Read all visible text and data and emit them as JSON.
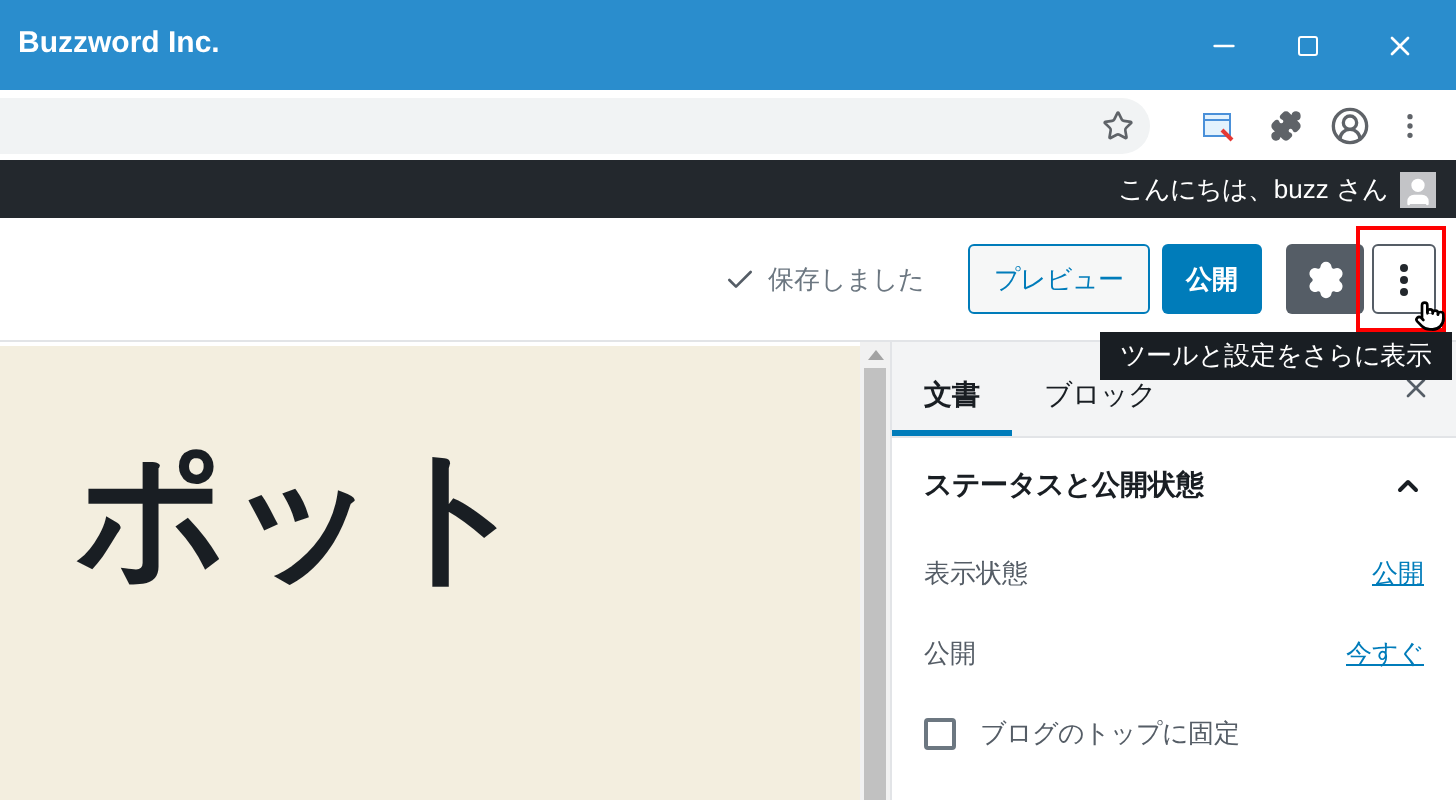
{
  "window": {
    "title": "Buzzword Inc."
  },
  "admin_bar": {
    "greeting": "こんにちは、buzz さん"
  },
  "header": {
    "saved_status": "保存しました",
    "preview_button": "プレビュー",
    "publish_button": "公開",
    "settings_selected": true,
    "more_tooltip": "ツールと設定をさらに表示"
  },
  "editor": {
    "title": "ポット"
  },
  "sidebar": {
    "tabs": [
      {
        "label": "文書",
        "selected": true
      },
      {
        "label": "ブロック",
        "selected": false
      }
    ],
    "panel": {
      "title": "ステータスと公開状態",
      "expanded": true,
      "rows": [
        {
          "kind": "link",
          "label": "表示状態",
          "value": "公開"
        },
        {
          "kind": "link",
          "label": "公開",
          "value": "今すぐ"
        },
        {
          "kind": "checkbox",
          "label": "ブログのトップに固定",
          "checked": false
        }
      ]
    }
  }
}
